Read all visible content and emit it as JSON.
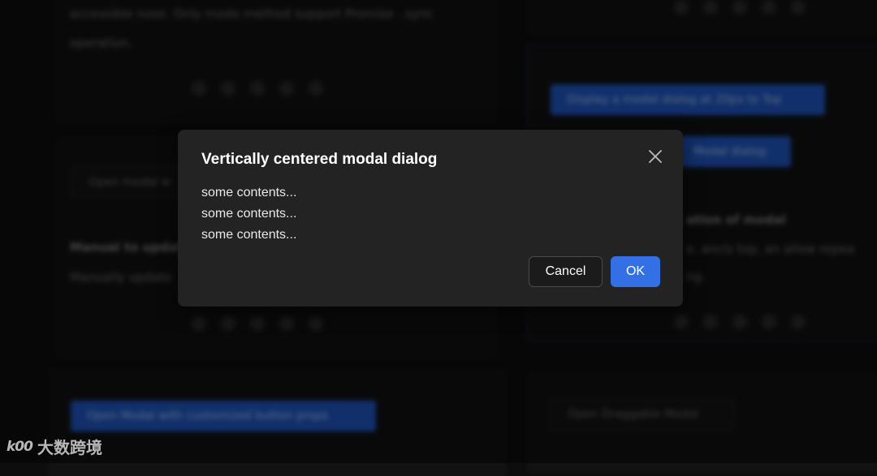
{
  "background": {
    "left_top_text_1": "accessible nose. Only modo method support Promise . sync",
    "left_top_text_2": "operation.",
    "left_mid_button": "Open modal w",
    "left_mid_heading": "Manual to update",
    "left_mid_text": "Manually update",
    "left_bot_button": "Open Modal with customized button props",
    "right_button_1": "Display a modal dialog at 20px to Top",
    "right_button_2": "Modal dialog",
    "right_heading": "ation of modal",
    "right_text_1": "e.    ancis top, an allow repea",
    "right_text_2": "ng.",
    "right_bot_button": "Open Draggable Modal"
  },
  "modal": {
    "title": "Vertically centered modal dialog",
    "lines": [
      "some contents...",
      "some contents...",
      "some contents..."
    ],
    "cancel_label": "Cancel",
    "ok_label": "OK",
    "close_icon": "close-icon"
  },
  "watermark": {
    "logo": "k00",
    "text": "大数跨境"
  },
  "colors": {
    "modal_bg": "#232324",
    "primary": "#3370e6",
    "backdrop": "#0d0d0e"
  }
}
